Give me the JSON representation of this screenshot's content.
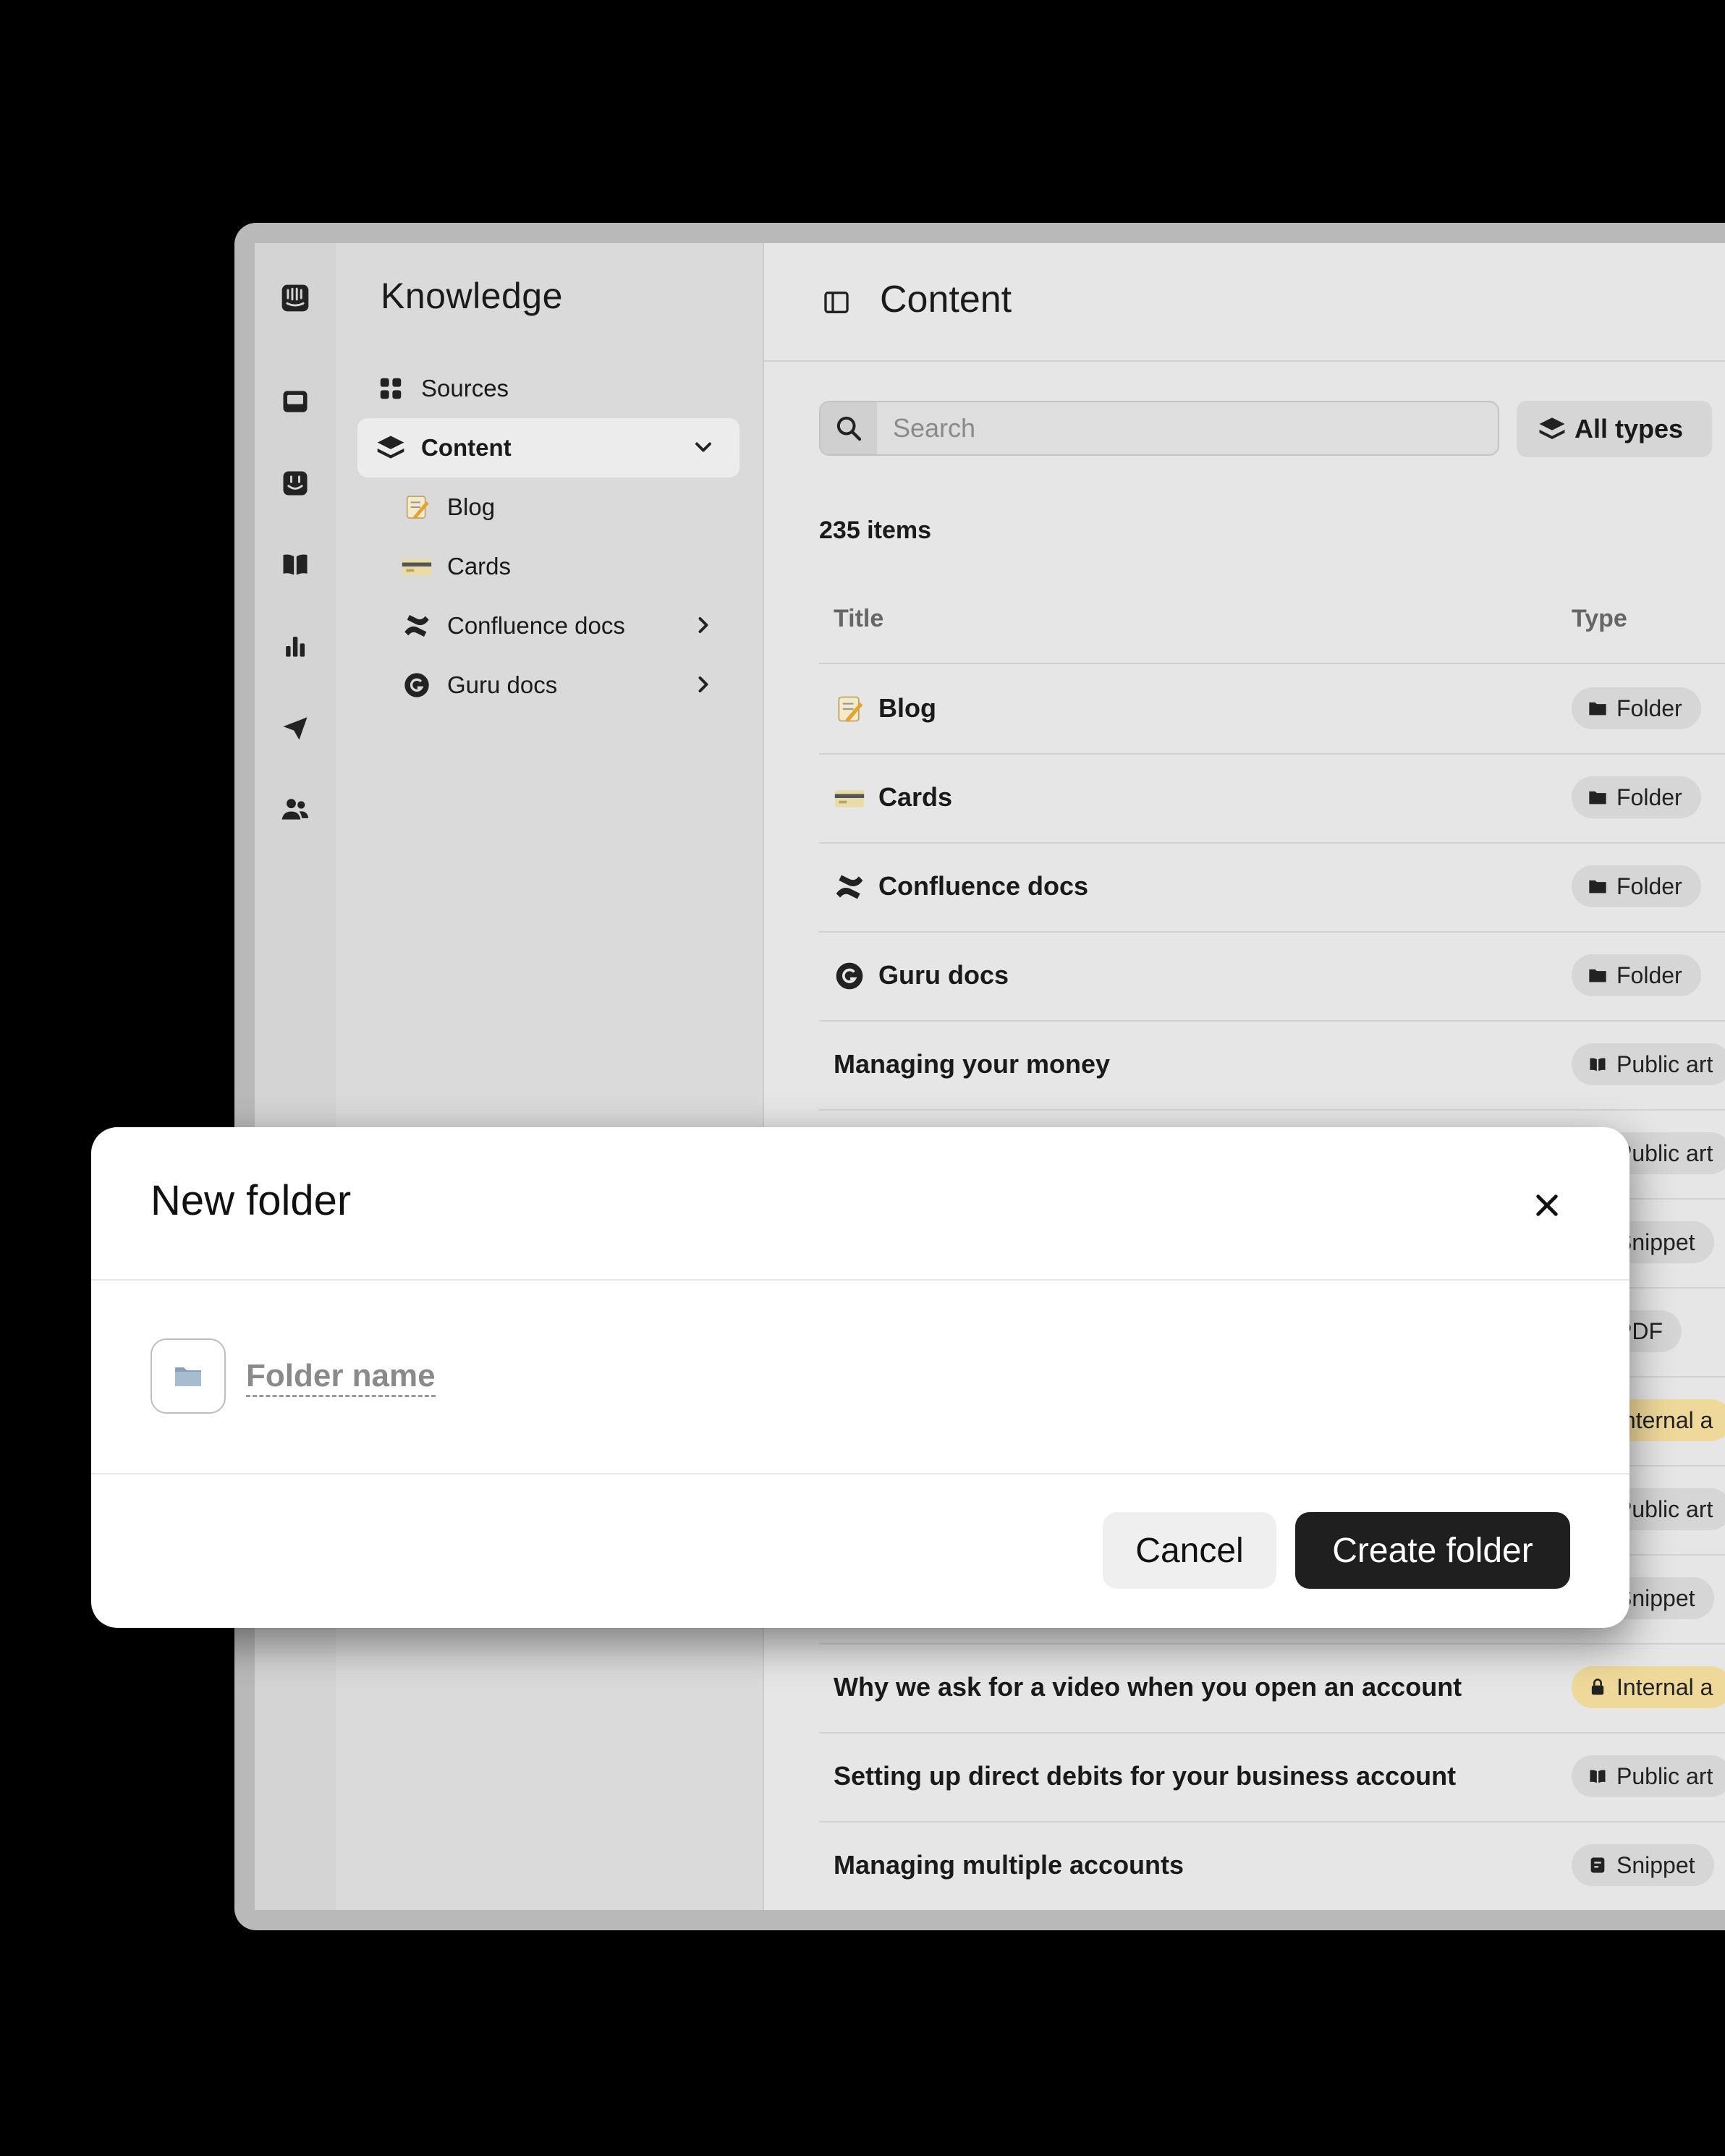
{
  "sidebar": {
    "title": "Knowledge",
    "items": [
      {
        "label": "Sources"
      },
      {
        "label": "Content"
      },
      {
        "label": "Blog"
      },
      {
        "label": "Cards"
      },
      {
        "label": "Confluence docs"
      },
      {
        "label": "Guru docs"
      }
    ]
  },
  "main": {
    "title": "Content",
    "search_placeholder": "Search",
    "type_filter": "All types",
    "count": "235 items",
    "columns": {
      "title": "Title",
      "type": "Type"
    },
    "rows": [
      {
        "title": "Blog",
        "type": "Folder"
      },
      {
        "title": "Cards",
        "type": "Folder"
      },
      {
        "title": "Confluence docs",
        "type": "Folder"
      },
      {
        "title": "Guru docs",
        "type": "Folder"
      },
      {
        "title": "Managing your money",
        "type": "Public art"
      },
      {
        "title": "",
        "type": "Public art"
      },
      {
        "title": "",
        "type": "Snippet"
      },
      {
        "title": "",
        "type": "PDF"
      },
      {
        "title": "",
        "type": "Internal a"
      },
      {
        "title": "",
        "type": "Public art"
      },
      {
        "title": "",
        "type": "Snippet"
      },
      {
        "title": "Why we ask for a video when you open an account",
        "type": "Internal a"
      },
      {
        "title": "Setting up direct debits for your business account",
        "type": "Public art"
      },
      {
        "title": "Managing multiple accounts",
        "type": "Snippet"
      }
    ]
  },
  "modal": {
    "title": "New folder",
    "name_placeholder": "Folder name",
    "cancel_label": "Cancel",
    "create_label": "Create folder"
  },
  "colors": {
    "internal_badge": "#efd99a",
    "primary_button": "#1f1f1f"
  },
  "icons": {
    "rail": [
      "intercom-logo-icon",
      "inbox-icon",
      "fin-icon",
      "book-icon",
      "bar-chart-icon",
      "send-icon",
      "people-icon"
    ]
  }
}
